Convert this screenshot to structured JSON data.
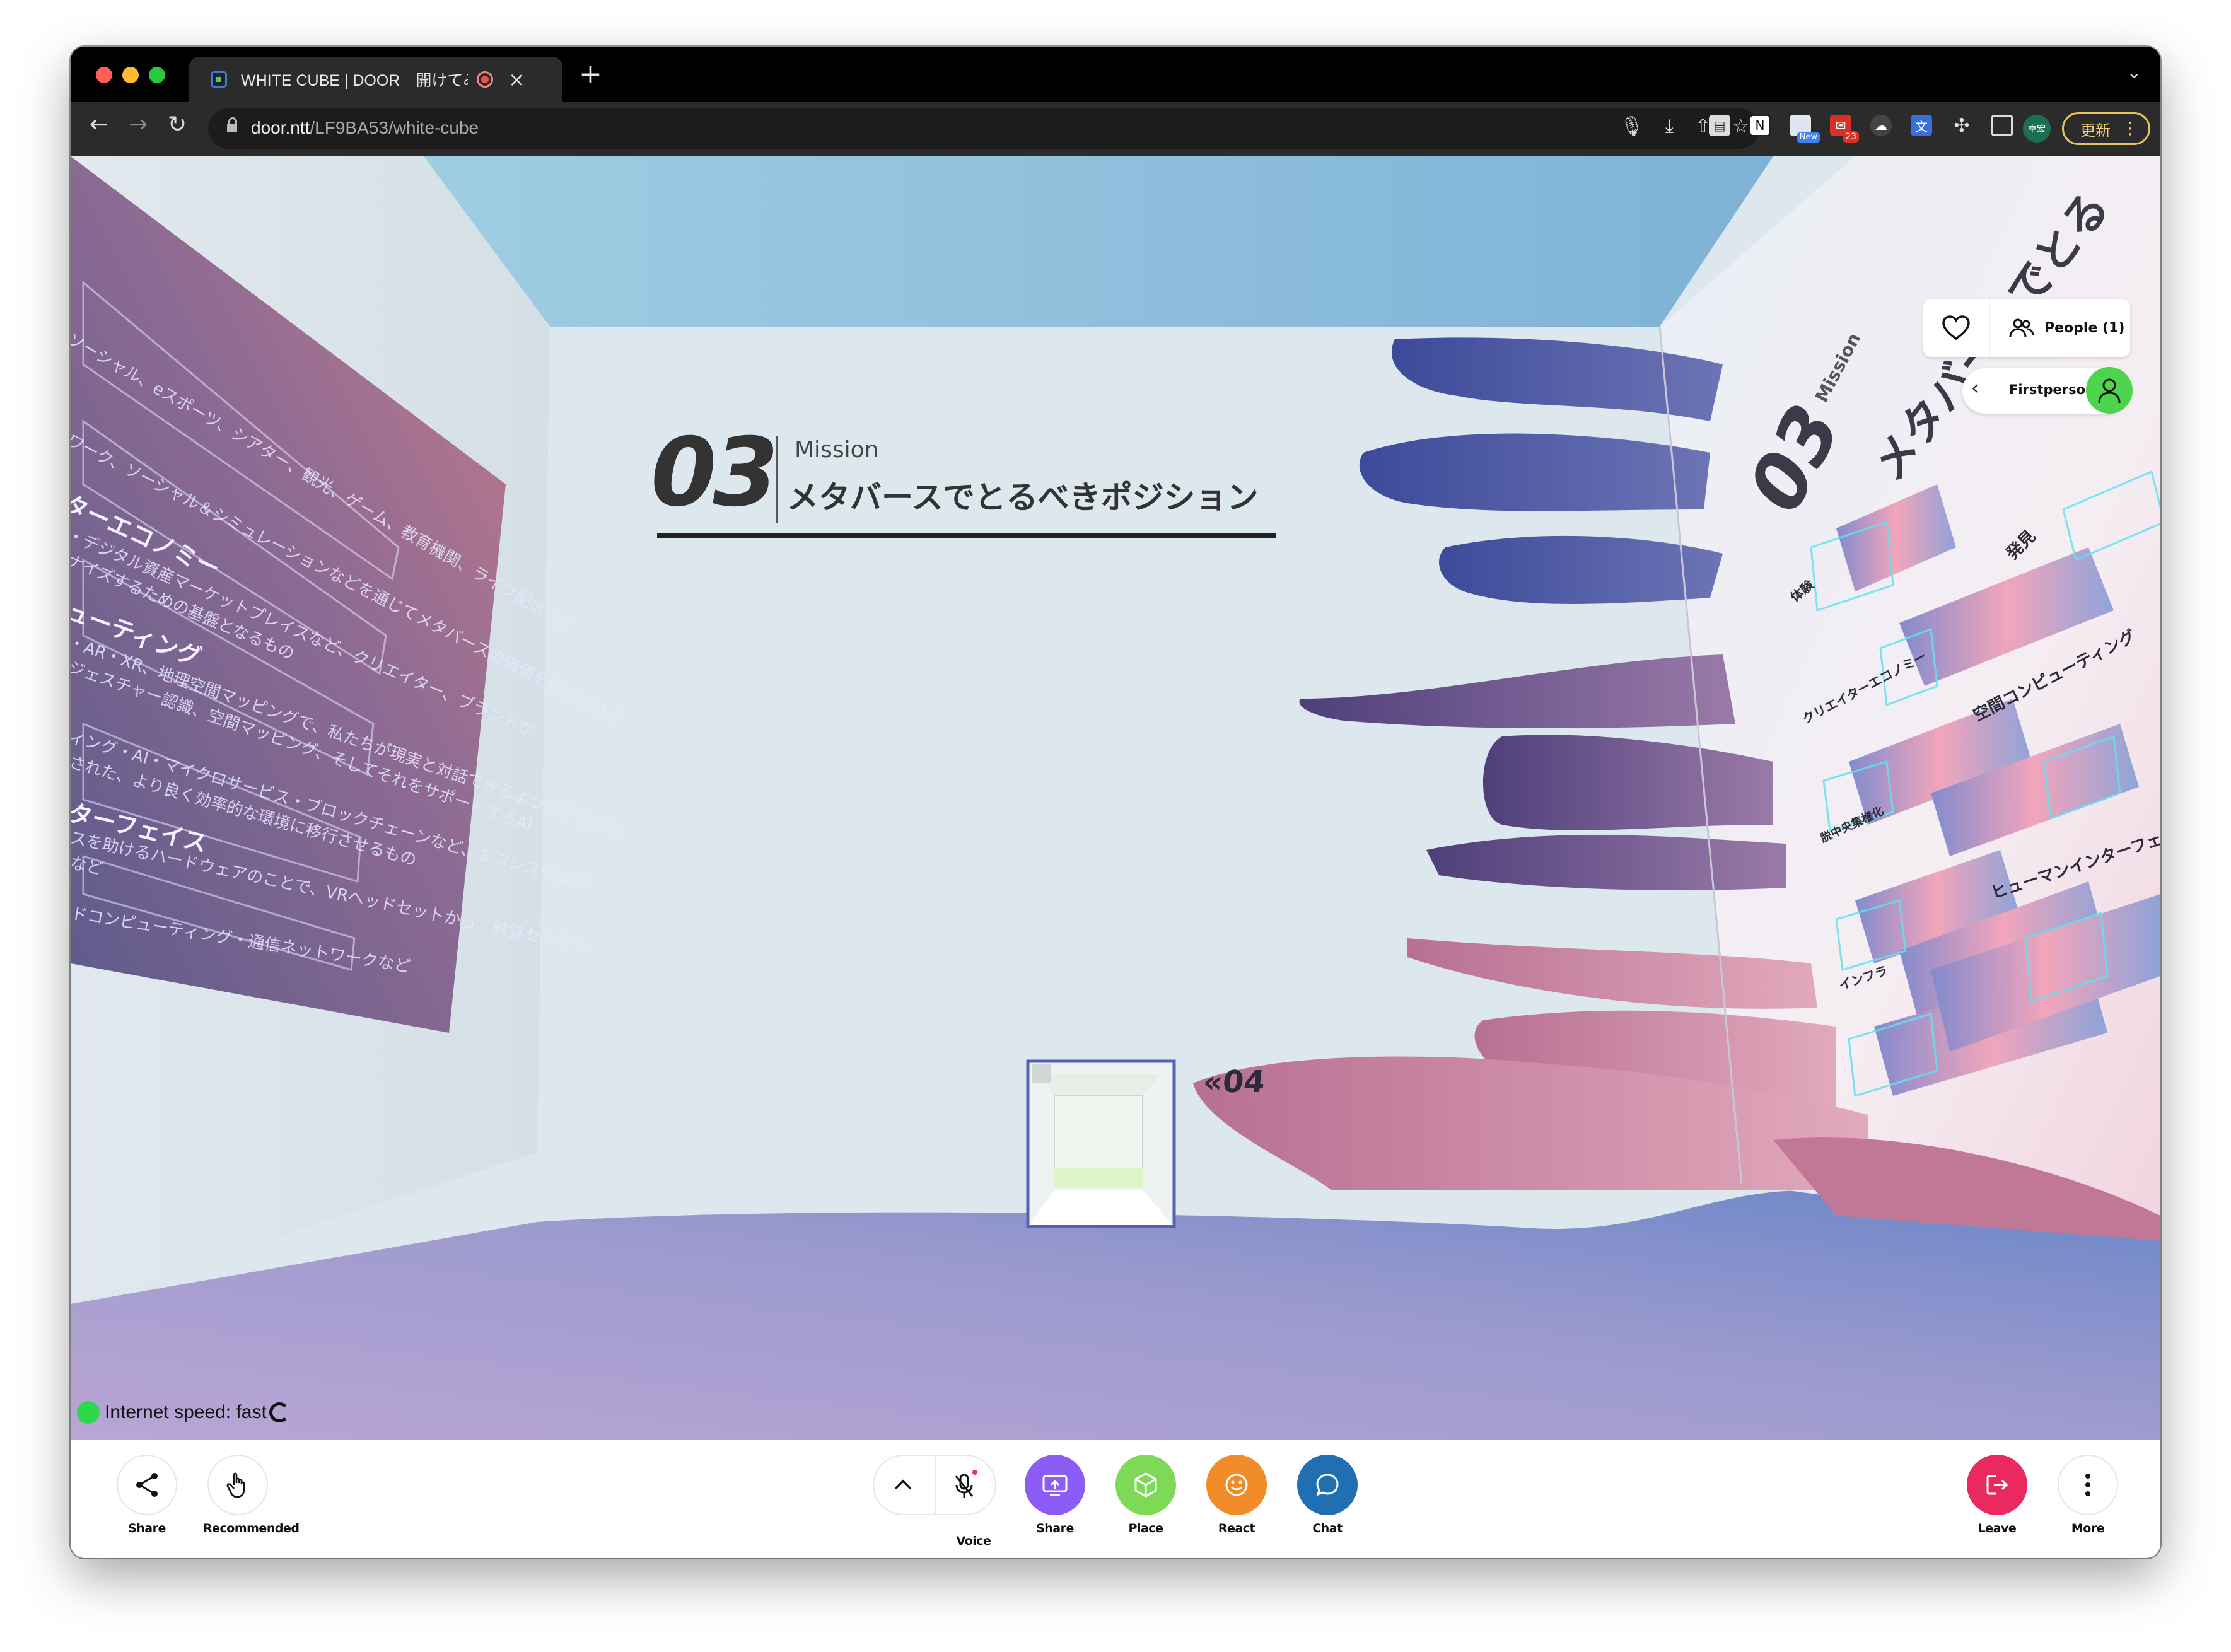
{
  "browser": {
    "tab_title": "WHITE CUBE | DOOR　開けてみよう",
    "tab_close": "×",
    "new_tab": "+",
    "url_host": "door.ntt",
    "url_path": "/LF9BA53/white-cube",
    "update_label": "更新",
    "profile_initials": "卓宏",
    "ext_badge_count": "23",
    "ext_new_label": "New",
    "colors": {
      "tabstrip": "#000000",
      "toolbar": "#2b2b2b",
      "update_accent": "#e8c35c"
    }
  },
  "scene": {
    "poster": {
      "number": "03",
      "subtitle": "Mission",
      "title": "メタバースでとるべきポジション"
    },
    "left_wall": {
      "lines": [
        "ソーシャル、eスポーツ、シアター、観光、ゲーム、教育機関、ライブ配信など",
        "ワーク、ソーシャル＆シミュレーションなどを通じてメタバースの価値を広げていく",
        "ターエコノミー",
        "・デジタル資産マーケットプレイスなど、クリエイター、ブランドが",
        "ナイズするための基盤となるもの",
        "ューティング",
        "・AR・XR、地理空間マッピングで、私たちが現実と対話できるようにするもの",
        "ジェスチャー認識、空間マッピング、そしてそれをサポートするAI",
        "ィング・AI・マイクロサービス・ブロックチェーンなど、エコシステムが",
        "された、より良く効率的な環境に移行させるもの",
        "ターフェイス",
        "スを助けるハードウェアのことで、VRヘッドセットから、触覚センサー",
        "など",
        "ドコンピューティング・通信ネットワークなど"
      ]
    },
    "right_wall": {
      "big_number": "03",
      "vertical_title": "メタバースでとる",
      "subtitle": "Mission",
      "labels": [
        "体験",
        "発見",
        "クリエイターエコノミー",
        "空間コンピューティング",
        "脱中央集権化",
        "ヒューマンインターフェイス",
        "インフラ"
      ]
    },
    "exit_sign": "«04",
    "internet_status": "Internet speed: fast",
    "colors": {
      "floor_start": "#b6a6d6",
      "floor_end": "#6b86c8",
      "ribbon_dark": "#3d4d9e",
      "ribbon_pink": "#c87c9c",
      "status_green": "#2bd94b"
    }
  },
  "overlay": {
    "people_label": "People (1)",
    "view_mode_label": "Firstperson"
  },
  "bottom_bar": {
    "share_left_label": "Share",
    "recommended_label": "Recommended",
    "voice_label": "Voice",
    "share_screen_label": "Share",
    "place_label": "Place",
    "react_label": "React",
    "chat_label": "Chat",
    "leave_label": "Leave",
    "more_label": "More",
    "colors": {
      "share": "#8b5cf6",
      "place": "#7ed957",
      "react": "#f28c28",
      "chat": "#1f6fb2",
      "leave": "#ea2a5e"
    }
  }
}
